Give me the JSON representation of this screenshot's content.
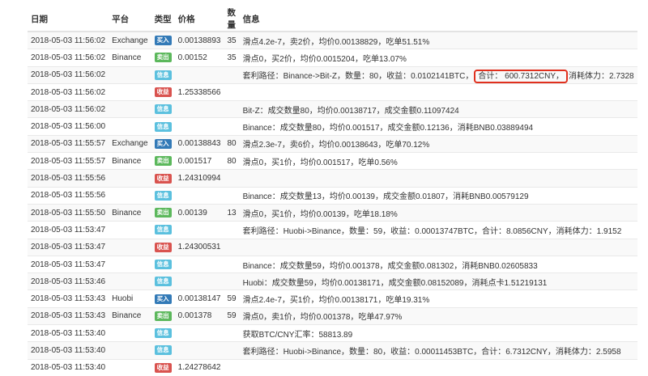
{
  "headers": {
    "date": "日期",
    "platform": "平台",
    "type": "类型",
    "price": "价格",
    "qty": "数量",
    "info": "信息"
  },
  "colors": {
    "buy": "#337ab7",
    "sell": "#5cb85c",
    "info": "#5bc0de",
    "profit": "#d9534f",
    "highlight": "#e0301e"
  },
  "rows": [
    {
      "date": "2018-05-03 11:56:02",
      "platform": "Exchange",
      "type": "买入",
      "kind": "buy",
      "price": "0.00138893",
      "qty": "35",
      "info": "滑点4.2e-7，卖2价，均价0.00138829，吃单51.51%"
    },
    {
      "date": "2018-05-03 11:56:02",
      "platform": "Binance",
      "type": "卖出",
      "kind": "sell",
      "price": "0.00152",
      "qty": "35",
      "info": "滑点0，买2价，均价0.0015204，吃单13.07%"
    },
    {
      "date": "2018-05-03 11:56:02",
      "platform": "",
      "type": "信息",
      "kind": "info",
      "price": "",
      "qty": "",
      "info": "套利路径：Binance->Bit-Z，数量：80，收益：0.0102141BTC，",
      "info_hl": "合计： 600.7312CNY，",
      "info_after": "消耗体力：2.7328"
    },
    {
      "date": "2018-05-03 11:56:02",
      "platform": "",
      "type": "收益",
      "kind": "profit",
      "price": "1.25338566",
      "qty": "",
      "info": ""
    },
    {
      "date": "2018-05-03 11:56:02",
      "platform": "",
      "type": "信息",
      "kind": "info",
      "price": "",
      "qty": "",
      "info": "Bit-Z：成交数量80，均价0.00138717，成交金额0.11097424"
    },
    {
      "date": "2018-05-03 11:56:00",
      "platform": "",
      "type": "信息",
      "kind": "info",
      "price": "",
      "qty": "",
      "info": "Binance：成交数量80，均价0.001517，成交金额0.12136，消耗BNB0.03889494"
    },
    {
      "date": "2018-05-03 11:55:57",
      "platform": "Exchange",
      "type": "买入",
      "kind": "buy",
      "price": "0.00138843",
      "qty": "80",
      "info": "滑点2.3e-7，卖6价，均价0.00138643，吃单70.12%"
    },
    {
      "date": "2018-05-03 11:55:57",
      "platform": "Binance",
      "type": "卖出",
      "kind": "sell",
      "price": "0.001517",
      "qty": "80",
      "info": "滑点0，买1价，均价0.001517，吃单0.56%"
    },
    {
      "date": "2018-05-03 11:55:56",
      "platform": "",
      "type": "收益",
      "kind": "profit",
      "price": "1.24310994",
      "qty": "",
      "info": ""
    },
    {
      "date": "2018-05-03 11:55:56",
      "platform": "",
      "type": "信息",
      "kind": "info",
      "price": "",
      "qty": "",
      "info": "Binance：成交数量13，均价0.00139，成交金额0.01807，消耗BNB0.00579129"
    },
    {
      "date": "2018-05-03 11:55:50",
      "platform": "Binance",
      "type": "卖出",
      "kind": "sell",
      "price": "0.00139",
      "qty": "13",
      "info": "滑点0，买1价，均价0.00139，吃单18.18%"
    },
    {
      "date": "2018-05-03 11:53:47",
      "platform": "",
      "type": "信息",
      "kind": "info",
      "price": "",
      "qty": "",
      "info": "套利路径：Huobi->Binance，数量：59，收益：0.00013747BTC，合计：8.0856CNY，消耗体力：1.9152"
    },
    {
      "date": "2018-05-03 11:53:47",
      "platform": "",
      "type": "收益",
      "kind": "profit",
      "price": "1.24300531",
      "qty": "",
      "info": ""
    },
    {
      "date": "2018-05-03 11:53:47",
      "platform": "",
      "type": "信息",
      "kind": "info",
      "price": "",
      "qty": "",
      "info": "Binance：成交数量59，均价0.001378，成交金额0.081302，消耗BNB0.02605833"
    },
    {
      "date": "2018-05-03 11:53:46",
      "platform": "",
      "type": "信息",
      "kind": "info",
      "price": "",
      "qty": "",
      "info": "Huobi：成交数量59，均价0.00138171，成交金额0.08152089，消耗点卡1.51219131"
    },
    {
      "date": "2018-05-03 11:53:43",
      "platform": "Huobi",
      "type": "买入",
      "kind": "buy",
      "price": "0.00138147",
      "qty": "59",
      "info": "滑点2.4e-7，买1价，均价0.00138171，吃单19.31%"
    },
    {
      "date": "2018-05-03 11:53:43",
      "platform": "Binance",
      "type": "卖出",
      "kind": "sell",
      "price": "0.001378",
      "qty": "59",
      "info": "滑点0，卖1价，均价0.001378，吃单47.97%"
    },
    {
      "date": "2018-05-03 11:53:40",
      "platform": "",
      "type": "信息",
      "kind": "info",
      "price": "",
      "qty": "",
      "info": "获取BTC/CNY汇率：58813.89"
    },
    {
      "date": "2018-05-03 11:53:40",
      "platform": "",
      "type": "信息",
      "kind": "info",
      "price": "",
      "qty": "",
      "info": "套利路径：Huobi->Binance，数量：80，收益：0.00011453BTC，合计：6.7312CNY，消耗体力：2.5958"
    },
    {
      "date": "2018-05-03 11:53:40",
      "platform": "",
      "type": "收益",
      "kind": "profit",
      "price": "1.24278642",
      "qty": "",
      "info": ""
    }
  ]
}
